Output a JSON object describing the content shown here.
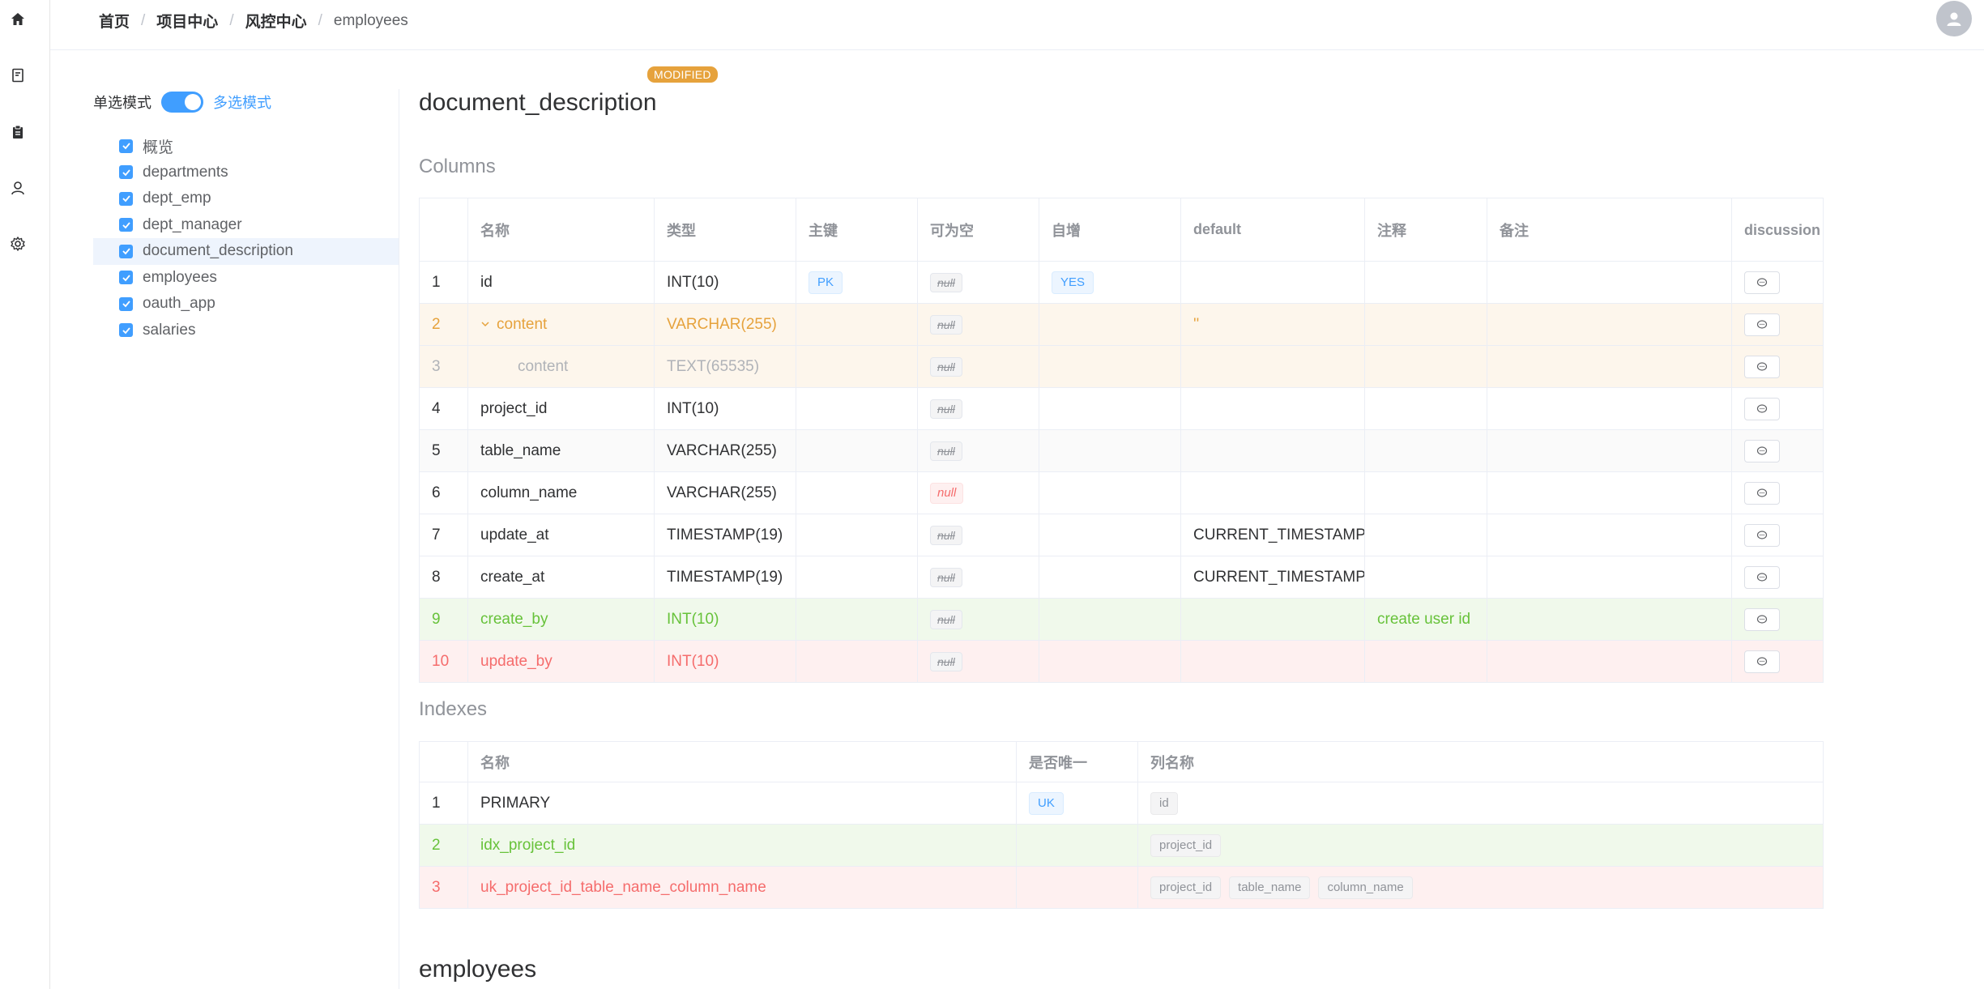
{
  "breadcrumb": [
    "首页",
    "项目中心",
    "风控中心",
    "employees"
  ],
  "rail_icons": [
    "home-icon",
    "book-icon",
    "clipboard-icon",
    "user-icon",
    "settings-icon"
  ],
  "mode": {
    "off_label": "单选模式",
    "on_label": "多选模式",
    "enabled": true
  },
  "tree": [
    {
      "label": "概览",
      "checked": true
    },
    {
      "label": "departments",
      "checked": true
    },
    {
      "label": "dept_emp",
      "checked": true
    },
    {
      "label": "dept_manager",
      "checked": true
    },
    {
      "label": "document_description",
      "checked": true,
      "selected": true
    },
    {
      "label": "employees",
      "checked": true
    },
    {
      "label": "oauth_app",
      "checked": true
    },
    {
      "label": "salaries",
      "checked": true
    }
  ],
  "table": {
    "name": "document_description",
    "badge": "MODIFIED",
    "columns_title": "Columns",
    "indexes_title": "Indexes",
    "column_headers": [
      "",
      "名称",
      "类型",
      "主键",
      "可为空",
      "自增",
      "default",
      "注释",
      "备注",
      "discussion"
    ],
    "columns": [
      {
        "no": "1",
        "name": "id",
        "type": "INT(10)",
        "pk": "PK",
        "nullable": "null",
        "auto": "YES",
        "default": "",
        "comment": "",
        "remark": "",
        "state": "normal"
      },
      {
        "no": "2",
        "name": "content",
        "type": "VARCHAR(255)",
        "pk": "",
        "nullable": "null",
        "auto": "",
        "default": "''",
        "comment": "",
        "remark": "",
        "state": "modified",
        "expanded": true
      },
      {
        "no": "3",
        "name": "content",
        "type": "TEXT(65535)",
        "pk": "",
        "nullable": "null",
        "auto": "",
        "default": "",
        "comment": "",
        "remark": "",
        "state": "modified-old"
      },
      {
        "no": "4",
        "name": "project_id",
        "type": "INT(10)",
        "pk": "",
        "nullable": "null",
        "auto": "",
        "default": "",
        "comment": "",
        "remark": "",
        "state": "normal"
      },
      {
        "no": "5",
        "name": "table_name",
        "type": "VARCHAR(255)",
        "pk": "",
        "nullable": "null",
        "auto": "",
        "default": "",
        "comment": "",
        "remark": "",
        "state": "striped"
      },
      {
        "no": "6",
        "name": "column_name",
        "type": "VARCHAR(255)",
        "pk": "",
        "nullable": "null",
        "nullable_required": true,
        "auto": "",
        "default": "",
        "comment": "",
        "remark": "",
        "state": "normal"
      },
      {
        "no": "7",
        "name": "update_at",
        "type": "TIMESTAMP(19)",
        "pk": "",
        "nullable": "null",
        "auto": "",
        "default": "CURRENT_TIMESTAMP",
        "comment": "",
        "remark": "",
        "state": "normal"
      },
      {
        "no": "8",
        "name": "create_at",
        "type": "TIMESTAMP(19)",
        "pk": "",
        "nullable": "null",
        "auto": "",
        "default": "CURRENT_TIMESTAMP",
        "comment": "",
        "remark": "",
        "state": "normal"
      },
      {
        "no": "9",
        "name": "create_by",
        "type": "INT(10)",
        "pk": "",
        "nullable": "null",
        "auto": "",
        "default": "",
        "comment": "create user id",
        "remark": "",
        "state": "added"
      },
      {
        "no": "10",
        "name": "update_by",
        "type": "INT(10)",
        "pk": "",
        "nullable": "null",
        "auto": "",
        "default": "",
        "comment": "",
        "remark": "",
        "state": "removed"
      }
    ],
    "index_headers": [
      "",
      "名称",
      "是否唯一",
      "列名称"
    ],
    "indexes": [
      {
        "no": "1",
        "name": "PRIMARY",
        "unique": "UK",
        "columns": [
          "id"
        ],
        "state": "normal"
      },
      {
        "no": "2",
        "name": "idx_project_id",
        "unique": "",
        "columns": [
          "project_id"
        ],
        "state": "added"
      },
      {
        "no": "3",
        "name": "uk_project_id_table_name_column_name",
        "unique": "",
        "columns": [
          "project_id",
          "table_name",
          "column_name"
        ],
        "state": "removed"
      }
    ]
  },
  "next_table_name": "employees",
  "colors": {
    "primary": "#409eff",
    "added": "#67c23a",
    "removed": "#f56c6c",
    "modified": "#e6a23c"
  }
}
